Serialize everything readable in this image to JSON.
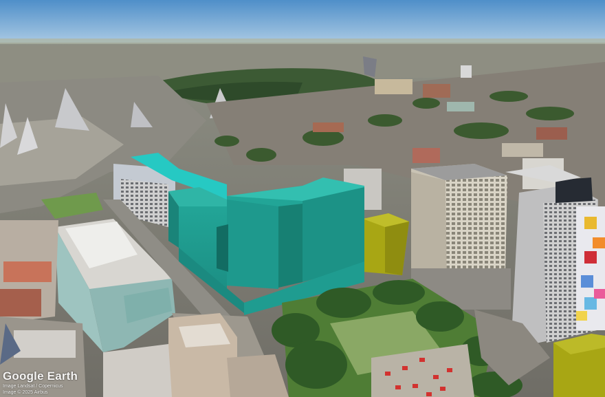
{
  "map": {
    "view": "3d-aerial-oblique",
    "highlight_colors": {
      "teal_buildings": "#1f9c90",
      "cyan_roof": "#26c9c3",
      "olive_buildings": "#a8a614"
    }
  },
  "watermark": {
    "logo": "Google Earth",
    "line1": "Image Landsat / Copernicus",
    "line2": "Image © 2025 Airbus"
  }
}
